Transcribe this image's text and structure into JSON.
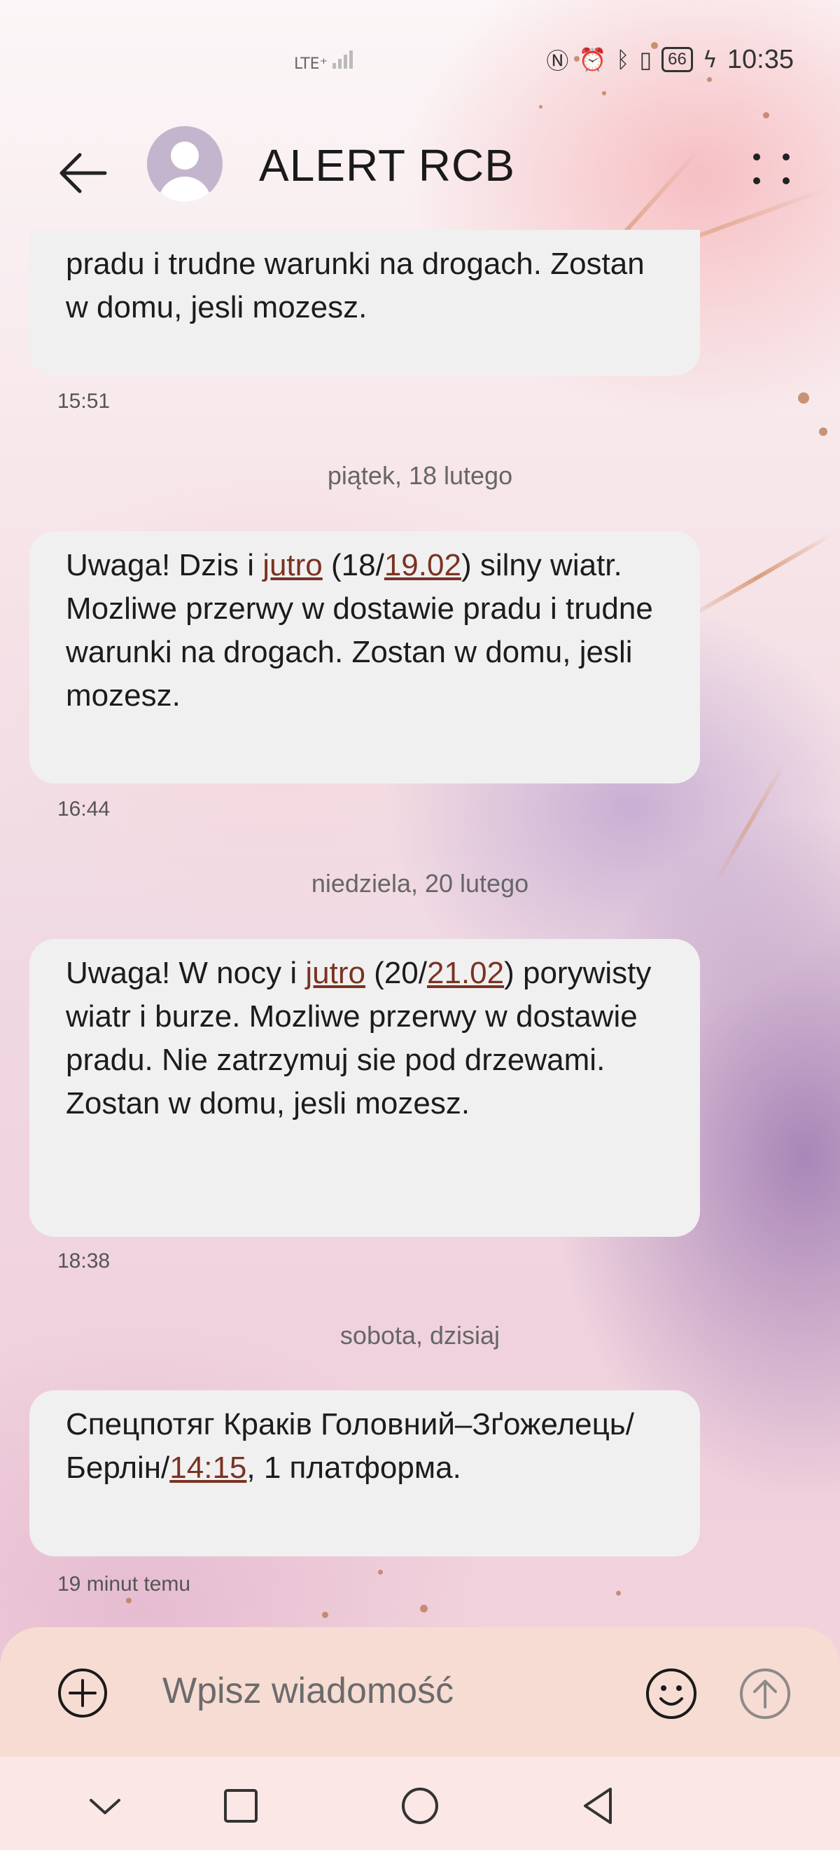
{
  "status_bar": {
    "network": "LTE⁺",
    "battery": "66",
    "time": "10:35",
    "icons": [
      "nfc-icon",
      "alarm-icon",
      "bluetooth-icon",
      "vibrate-icon",
      "battery-icon",
      "charging-icon"
    ]
  },
  "header": {
    "title": "ALERT RCB",
    "back_icon": "arrow-left-icon",
    "avatar_icon": "contact-avatar-icon",
    "more_icon": "more-dots-icon"
  },
  "messages": [
    {
      "parts": [
        {
          "t": "pradu i trudne warunki na drogach. Zostan w domu, jesli mozesz."
        }
      ],
      "time": "15:51"
    },
    {
      "date": "piątek, 18 lutego",
      "parts": [
        {
          "t": "Uwaga! Dzis i "
        },
        {
          "t": "jutro",
          "link": true
        },
        {
          "t": " (18/"
        },
        {
          "t": "19.02",
          "link": true
        },
        {
          "t": ") silny wiatr. Mozliwe przerwy w dostawie pradu i trudne warunki na drogach. Zostan w domu, jesli mozesz."
        }
      ],
      "time": "16:44"
    },
    {
      "date": "niedziela, 20 lutego",
      "parts": [
        {
          "t": "Uwaga! W nocy i "
        },
        {
          "t": "jutro",
          "link": true
        },
        {
          "t": " (20/"
        },
        {
          "t": "21.02",
          "link": true
        },
        {
          "t": ") porywisty wiatr i burze. Mozliwe przerwy w dostawie pradu. Nie zatrzymuj sie pod drzewami. Zostan w domu, jesli mozesz."
        }
      ],
      "time": "18:38"
    },
    {
      "date": "sobota, dzisiaj",
      "parts": [
        {
          "t": "Спецпотяг Краків Головний–Зґожелець/Берлін/"
        },
        {
          "t": "14:15",
          "link": true
        },
        {
          "t": ", 1 платформа."
        }
      ],
      "time": "19 minut temu"
    }
  ],
  "composer": {
    "placeholder": "Wpisz wiadomość",
    "add_icon": "plus-circle-icon",
    "emoji_icon": "smiley-icon",
    "send_icon": "send-arrow-icon"
  },
  "navbar": {
    "icons": [
      "chevron-down-icon",
      "recents-square-icon",
      "home-circle-icon",
      "back-triangle-icon"
    ]
  },
  "colors": {
    "bubble": "#f1f0f1",
    "link": "#7a3322",
    "composer": "#f7dcd4",
    "navbar": "#fbe8e6"
  }
}
